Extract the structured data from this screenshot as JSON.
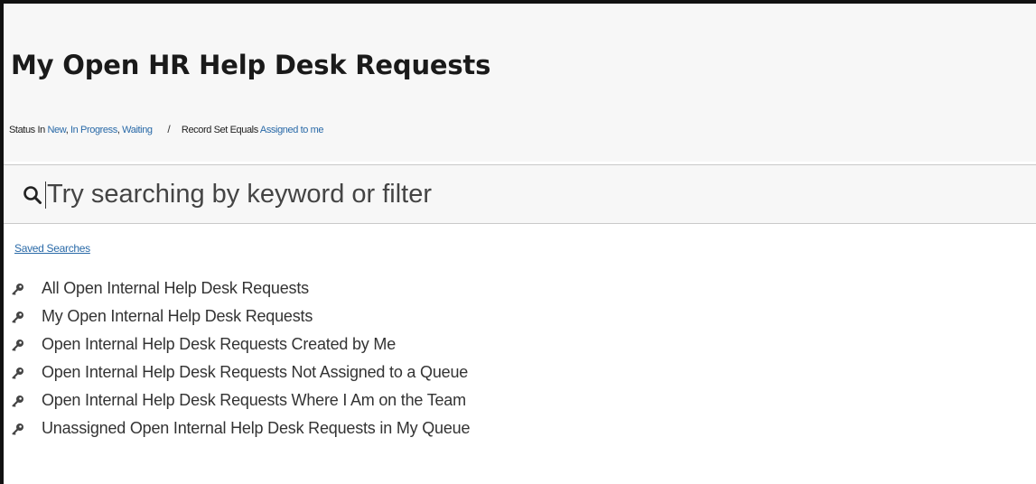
{
  "header": {
    "title": "My Open HR Help Desk Requests",
    "filter": {
      "status_label": "Status In",
      "status_values": [
        "New",
        "In Progress",
        "Waiting"
      ],
      "separator": "/",
      "record_label": "Record Set Equals",
      "record_value": "Assigned to me"
    }
  },
  "search": {
    "icon": "search-icon",
    "placeholder": "Try searching by keyword or filter",
    "value": ""
  },
  "saved_searches": {
    "label": "Saved Searches",
    "icon": "key-icon",
    "items": [
      {
        "label": "All Open Internal Help Desk Requests"
      },
      {
        "label": "My Open Internal Help Desk Requests"
      },
      {
        "label": "Open Internal Help Desk Requests Created by Me"
      },
      {
        "label": "Open Internal Help Desk Requests Not Assigned to a Queue"
      },
      {
        "label": "Open Internal Help Desk Requests Where I Am on the Team"
      },
      {
        "label": "Unassigned Open Internal Help Desk Requests in My Queue"
      }
    ]
  },
  "colors": {
    "link": "#2a6aa8",
    "header_bg": "#f7f7f7",
    "text": "#333333"
  }
}
